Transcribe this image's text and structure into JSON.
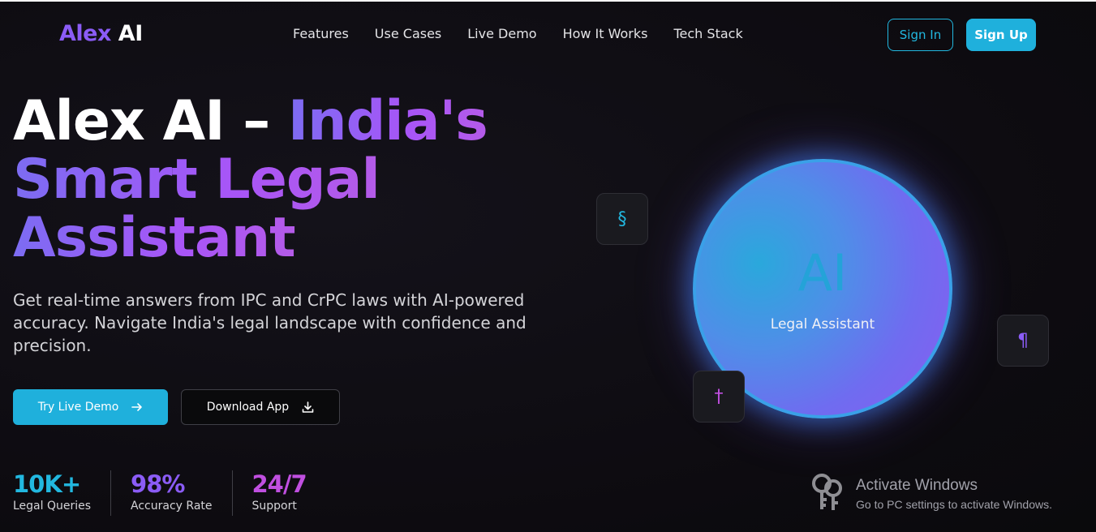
{
  "brand": {
    "part1": "Alex",
    "part2": "AI"
  },
  "nav": {
    "items": [
      "Features",
      "Use Cases",
      "Live Demo",
      "How It Works",
      "Tech Stack"
    ],
    "signin_label": "Sign In",
    "signup_label": "Sign Up"
  },
  "hero": {
    "title_line1_white": "Alex AI – ",
    "title_line1_grad": "India's",
    "title_line2": "Smart Legal",
    "title_line3": "Assistant",
    "subtitle": "Get real-time answers from IPC and CrPC laws with AI-powered accuracy. Navigate India's legal landscape with confidence and precision.",
    "demo_label": "Try Live Demo",
    "download_label": "Download App"
  },
  "stats": [
    {
      "value": "10K+",
      "label": "Legal Queries",
      "color": "#22b8e0"
    },
    {
      "value": "98%",
      "label": "Accuracy Rate",
      "color": "#8b5cf6"
    },
    {
      "value": "24/7",
      "label": "Support",
      "color": "#c04fe0"
    }
  ],
  "orb": {
    "title": "AI",
    "label": "Legal Assistant"
  },
  "symbols": {
    "section": "§",
    "paragraph": "¶",
    "dagger": "†"
  },
  "watermark": {
    "title": "Activate Windows",
    "subtitle": "Go to PC settings to activate Windows."
  },
  "colors": {
    "accent_cyan": "#1fb0dc",
    "accent_purple": "#8b5cf6",
    "accent_magenta": "#c04fe0"
  },
  "icons": {
    "demo": "arrow-right-icon",
    "download": "download-icon",
    "watermark": "key-icon"
  }
}
